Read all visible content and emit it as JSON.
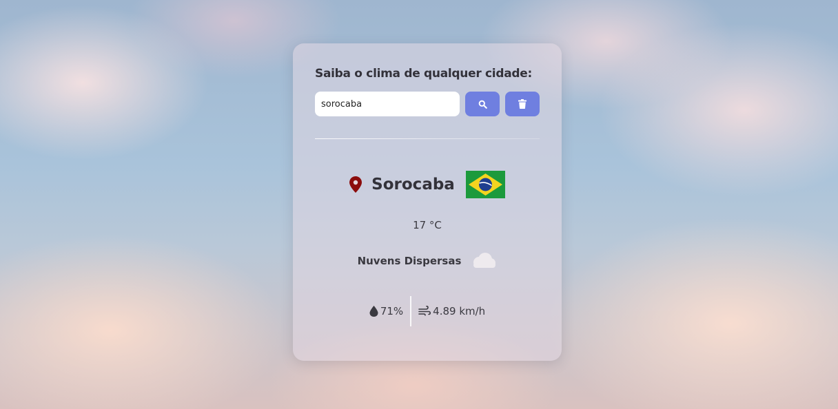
{
  "app": {
    "heading": "Saiba o clima de qualquer cidade:"
  },
  "search": {
    "value": "sorocaba",
    "search_icon": "search-icon",
    "clear_icon": "trash-icon"
  },
  "weather": {
    "city": "Sorocaba",
    "country_flag": "brazil-flag",
    "location_icon": "map-pin-icon",
    "temperature": "17 °C",
    "description": "Nuvens Dispersas",
    "description_icon": "cloud-icon",
    "humidity": "71%",
    "humidity_icon": "water-drop-icon",
    "wind": "4.89 km/h",
    "wind_icon": "wind-icon"
  },
  "colors": {
    "accent": "#6f7fe0",
    "pin": "#8b0c0c",
    "text": "#33323a"
  }
}
